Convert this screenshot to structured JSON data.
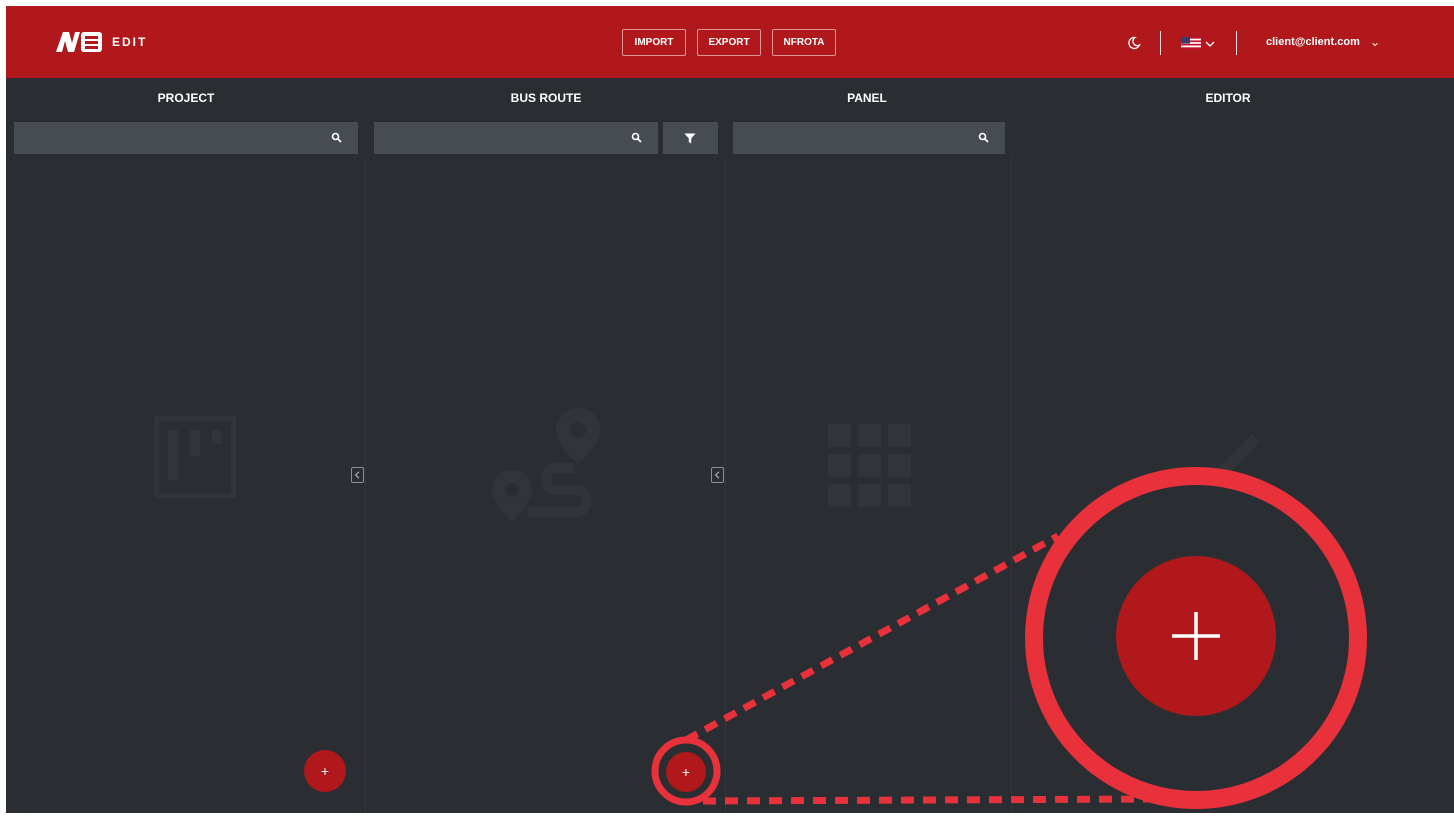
{
  "header": {
    "app_label": "EDIT",
    "buttons": {
      "import": "IMPORT",
      "export": "EXPORT",
      "nfrota": "NFROTA"
    },
    "user_email": "client@client.com",
    "brand_color": "#b0181b"
  },
  "columns": {
    "project": {
      "title": "PROJECT"
    },
    "bus_route": {
      "title": "BUS ROUTE"
    },
    "panel": {
      "title": "PANEL"
    },
    "editor": {
      "title": "EDITOR"
    }
  },
  "fab": {
    "label": "+"
  },
  "highlight_color": "#e8313a",
  "icons": [
    "logo-icon",
    "moon-icon",
    "us-flag-icon",
    "chevron-down-icon",
    "search-icon",
    "filter-icon",
    "chevron-left-icon",
    "plus-icon",
    "board-icon",
    "route-icon",
    "grid-icon",
    "pencil-icon"
  ]
}
